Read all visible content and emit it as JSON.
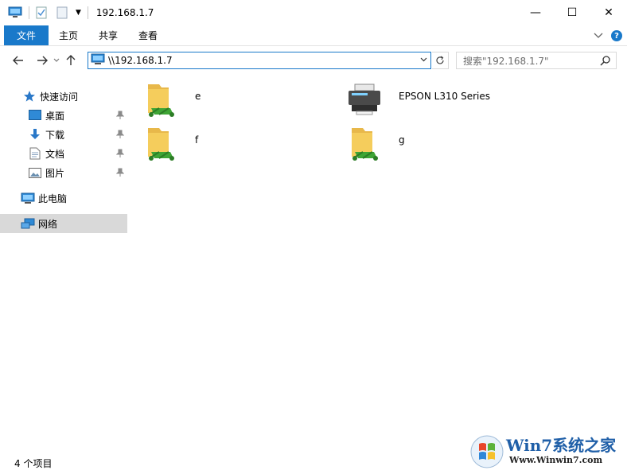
{
  "window": {
    "title": "192.168.1.7",
    "controls": {
      "minimize": "—",
      "maximize": "☐",
      "close": "✕"
    }
  },
  "ribbon": {
    "file_tab": "文件",
    "tabs": [
      "主页",
      "共享",
      "查看"
    ]
  },
  "address": {
    "path": "\\\\192.168.1.7",
    "search_placeholder": "搜索\"192.168.1.7\""
  },
  "nav": {
    "quick_access": "快速访问",
    "desktop": "桌面",
    "downloads": "下载",
    "documents": "文档",
    "pictures": "图片",
    "this_pc": "此电脑",
    "network": "网络"
  },
  "items": [
    {
      "name": "e",
      "kind": "shared-folder"
    },
    {
      "name": "EPSON L310 Series",
      "kind": "printer"
    },
    {
      "name": "f",
      "kind": "shared-folder"
    },
    {
      "name": "g",
      "kind": "shared-folder"
    }
  ],
  "status": {
    "count": "4 个项目"
  },
  "watermark": {
    "title": "Win7系统之家",
    "url": "Www.Winwin7.com"
  },
  "colors": {
    "accent": "#1979ca",
    "folder": "#f5cd5c",
    "share": "#3fa535"
  },
  "icons": [
    "computer-icon",
    "properties-icon",
    "new-folder-icon",
    "back-arrow-icon",
    "forward-arrow-icon",
    "up-arrow-icon",
    "refresh-icon",
    "search-icon",
    "star-icon",
    "pin-icon",
    "shared-folder-icon",
    "printer-icon",
    "network-icon"
  ]
}
